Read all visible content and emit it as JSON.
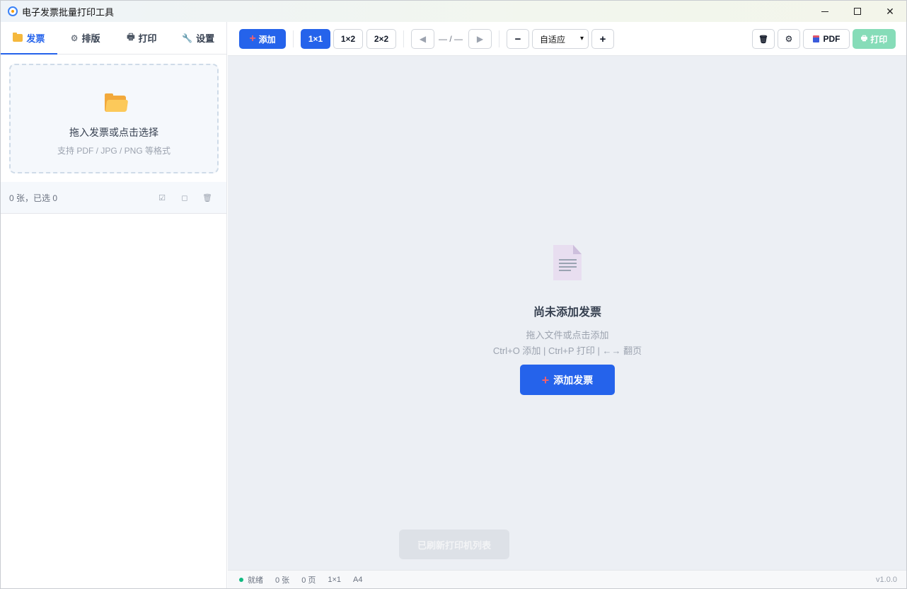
{
  "window": {
    "title": "电子发票批量打印工具",
    "controls": {
      "minimize": "",
      "maximize": "",
      "close": "✕"
    }
  },
  "sidebar": {
    "tabs": [
      {
        "label": "发票",
        "icon": "folder-icon"
      },
      {
        "label": "排版",
        "icon": "gear-icon",
        "glyph": "⚙"
      },
      {
        "label": "打印",
        "icon": "printer-icon",
        "glyph": "🖶"
      },
      {
        "label": "设置",
        "icon": "wrench-icon",
        "glyph": "🔧"
      }
    ],
    "dropzone": {
      "title": "拖入发票或点击选择",
      "hint": "支持 PDF / JPG / PNG 等格式"
    },
    "list": {
      "count_text": "0 张，已选 0",
      "select_all_glyph": "☑",
      "deselect_glyph": "◻",
      "delete_glyph": "🗑"
    }
  },
  "toolbar": {
    "add_label": "添加",
    "layouts": [
      "1×1",
      "1×2",
      "2×2"
    ],
    "active_layout": "1×1",
    "prev_glyph": "◀",
    "next_glyph": "▶",
    "page_indicator": "— / —",
    "zoom_out": "−",
    "zoom_value": "自适应",
    "zoom_in": "+",
    "clear_glyph": "🗑",
    "settings_glyph": "⚙",
    "pdf_label": "PDF",
    "print_label": "打印"
  },
  "empty_state": {
    "title": "尚未添加发票",
    "hint1": "拖入文件或点击添加",
    "hint2": "Ctrl+O 添加 | Ctrl+P 打印 | ←→ 翻页",
    "button": "添加发票"
  },
  "toast": {
    "text": "已刷新打印机列表"
  },
  "status": {
    "state": "就绪",
    "count": "0 张",
    "pages": "0 页",
    "layout": "1×1",
    "paper": "A4",
    "version": "v1.0.0"
  },
  "colors": {
    "primary": "#2563eb",
    "print_disabled": "#86dcb8",
    "status_ok": "#10b981",
    "accent_plus": "#f0616d"
  }
}
